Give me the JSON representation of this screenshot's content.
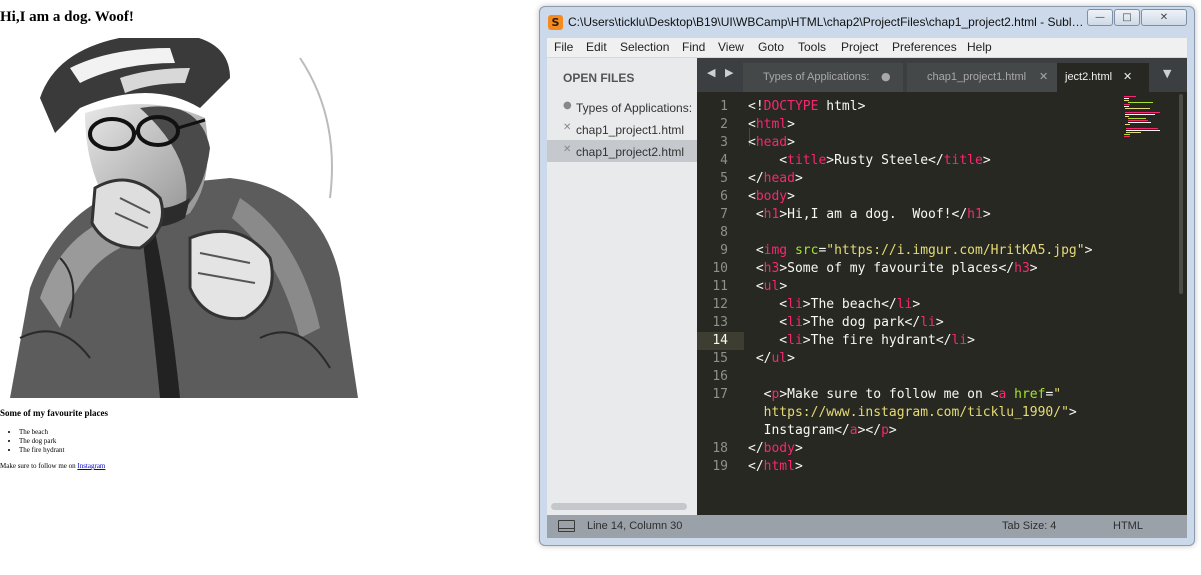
{
  "web_page": {
    "heading": "Hi,I am a dog. Woof!",
    "image_alt": "Black and white sketch-style portrait of a cyclist wearing a helmet and glasses, fists raised",
    "subheading": "Some of my favourite places",
    "places": [
      "The beach",
      "The dog park",
      "The fire hydrant"
    ],
    "follow_text": "Make sure to follow me on ",
    "follow_link": "Instagram"
  },
  "window": {
    "title": "C:\\Users\\ticklu\\Desktop\\B19\\UI\\WBCamp\\HTML\\chap2\\ProjectFiles\\chap1_project2.html - Sublime Text",
    "app_icon": "S",
    "controls": {
      "minimize": "—",
      "maximize": "□",
      "close": "✕"
    }
  },
  "menu": [
    "File",
    "Edit",
    "Selection",
    "Find",
    "View",
    "Goto",
    "Tools",
    "Project",
    "Preferences",
    "Help"
  ],
  "sidebar": {
    "title": "OPEN FILES",
    "files": [
      {
        "icon": "●",
        "name": "Types of Applications:",
        "active": false
      },
      {
        "icon": "✕",
        "name": "chap1_project1.html",
        "active": false
      },
      {
        "icon": "✕",
        "name": "chap1_project2.html",
        "active": true
      }
    ]
  },
  "tabs": {
    "nav_arrows": "◀ ▶",
    "items": [
      {
        "label": "Types of Applications:",
        "mark": "●"
      },
      {
        "label": "chap1_project1.html",
        "mark": "✕"
      },
      {
        "label": "ject2.html",
        "mark": "✕"
      }
    ],
    "dropdown": "▼"
  },
  "editor": {
    "current_line": 14,
    "lines": [
      {
        "n": "1",
        "html": "&lt;!<span class=\"tg\">DOCTYPE</span> html&gt;"
      },
      {
        "n": "2",
        "html": "&lt;<span class=\"tg\">html</span>&gt;"
      },
      {
        "n": "3",
        "html": "&lt;<span class=\"tg\">head</span>&gt;"
      },
      {
        "n": "4",
        "html": "    &lt;<span class=\"tg\">title</span>&gt;Rusty Steele&lt;/<span class=\"tg\">title</span>&gt;"
      },
      {
        "n": "5",
        "html": "&lt;/<span class=\"tg\">head</span>&gt;"
      },
      {
        "n": "6",
        "html": "&lt;<span class=\"tg\">body</span>&gt;"
      },
      {
        "n": "7",
        "html": " &lt;<span class=\"tg\">h1</span>&gt;Hi,I am a dog.  Woof!&lt;/<span class=\"tg\">h1</span>&gt;"
      },
      {
        "n": "8",
        "html": ""
      },
      {
        "n": "9",
        "html": " &lt;<span class=\"tg\">img</span> <span class=\"at\">src</span>=<span class=\"st\">\"https://i.imgur.com/HritKA5.jpg\"</span>&gt;"
      },
      {
        "n": "10",
        "html": " &lt;<span class=\"tg\">h3</span>&gt;Some of my favourite places&lt;/<span class=\"tg\">h3</span>&gt;"
      },
      {
        "n": "11",
        "html": " &lt;<span class=\"tg\">ul</span>&gt;"
      },
      {
        "n": "12",
        "html": "    &lt;<span class=\"tg\">li</span>&gt;The beach&lt;/<span class=\"tg\">li</span>&gt;"
      },
      {
        "n": "13",
        "html": "    &lt;<span class=\"tg\">li</span>&gt;The dog park&lt;/<span class=\"tg\">li</span>&gt;"
      },
      {
        "n": "14",
        "html": "    &lt;<span class=\"tg\">li</span>&gt;The fire hydrant&lt;/<span class=\"tg\">li</span>&gt;"
      },
      {
        "n": "15",
        "html": " &lt;/<span class=\"tg\">ul</span>&gt;"
      },
      {
        "n": "16",
        "html": ""
      },
      {
        "n": "17",
        "html": "  &lt;<span class=\"tg\">p</span>&gt;Make sure to follow me on &lt;<span class=\"tg\">a</span> <span class=\"at\">href</span>=<span class=\"st\">\"</span>"
      },
      {
        "n": "",
        "html": "  <span class=\"st\">https://www.instagram.com/ticklu_1990/\"</span>&gt;"
      },
      {
        "n": "",
        "html": "  Instagram&lt;/<span class=\"tg\">a</span>&gt;&lt;/<span class=\"tg\">p</span>&gt;"
      },
      {
        "n": "18",
        "html": "&lt;/<span class=\"tg\">body</span>&gt;"
      },
      {
        "n": "19",
        "html": "&lt;/<span class=\"tg\">html</span>&gt;"
      }
    ]
  },
  "statusbar": {
    "position": "Line 14, Column 30",
    "tab_size": "Tab Size: 4",
    "syntax": "HTML"
  },
  "colors": {
    "editor_bg": "#272822",
    "tag": "#f92672",
    "attribute": "#a6e22e",
    "string": "#e6db74",
    "text": "#f8f8f2",
    "line_number": "#90908a",
    "window_frame": "#cbd9ea",
    "status_bar": "#9aa1a9"
  }
}
